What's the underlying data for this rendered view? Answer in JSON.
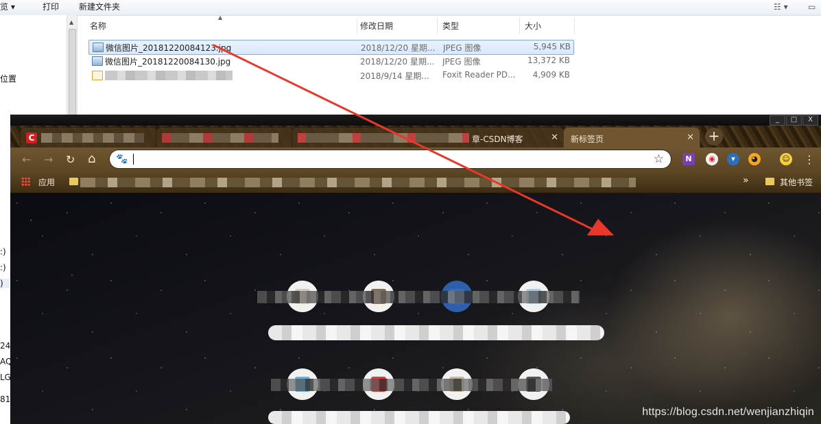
{
  "explorer": {
    "toolbar": {
      "preview_fragment": "览",
      "print": "打印",
      "new_folder": "新建文件夹"
    },
    "left_nav": [
      "位置",
      ":)",
      ":)",
      ")",
      "24",
      "AQ",
      "LG",
      "81"
    ],
    "columns": {
      "name": "名称",
      "modified": "修改日期",
      "type": "类型",
      "size": "大小"
    },
    "files": [
      {
        "name": "微信图片_20181220084123.jpg",
        "date": "2018/12/20 星期...",
        "type": "JPEG 图像",
        "size": "5,945 KB"
      },
      {
        "name": "微信图片_20181220084130.jpg",
        "date": "2018/12/20 星期...",
        "type": "JPEG 图像",
        "size": "13,372 KB"
      },
      {
        "name": "",
        "date": "2018/9/14 星期...",
        "type": "Foxit Reader PD...",
        "size": "4,909 KB"
      }
    ]
  },
  "chrome": {
    "window_controls": {
      "minimize": "_",
      "maximize": "□",
      "close": "X"
    },
    "tabs": [
      {
        "title": "C",
        "close": ""
      },
      {
        "title": "",
        "close": ""
      },
      {
        "title": "章-CSDN博客",
        "close": "✕"
      },
      {
        "title": "新标签页",
        "close": "✕"
      }
    ],
    "new_tab": "+",
    "omnibox": {
      "value": "",
      "star": "☆"
    },
    "nav_glyphs": {
      "back": "←",
      "forward": "→",
      "reload": "↻",
      "home": "⌂",
      "menu": "⋮"
    },
    "extensions": [
      "onenote-icon",
      "cast-icon",
      "shield-icon",
      "owl-icon",
      "avatar-icon"
    ],
    "bookmarks": {
      "apps": "应用",
      "overflow": "»",
      "other": "其他书签"
    },
    "watermark": "https://blog.csdn.net/wenjianzhiqin"
  },
  "colors": {
    "annotation_arrow": "#e8382b",
    "selection": "#d8e8fb",
    "chrome_frame": "#6f5530"
  }
}
